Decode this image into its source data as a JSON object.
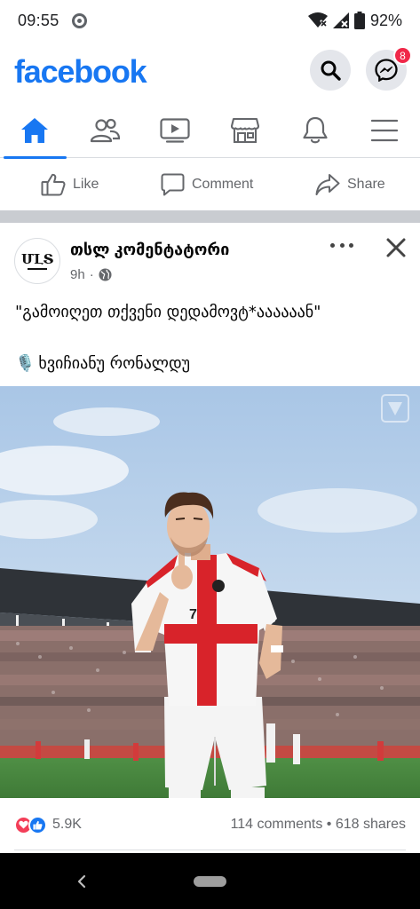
{
  "status_bar": {
    "time": "09:55",
    "battery": "92%"
  },
  "header": {
    "logo": "facebook",
    "messenger_badge": "8",
    "brand_color": "#1877f2",
    "badge_color": "#f02849"
  },
  "tabs": [
    {
      "name": "home",
      "icon": "home-icon",
      "active": true
    },
    {
      "name": "friends",
      "icon": "friends-icon",
      "active": false
    },
    {
      "name": "watch",
      "icon": "video-icon",
      "active": false
    },
    {
      "name": "marketplace",
      "icon": "store-icon",
      "active": false
    },
    {
      "name": "notifications",
      "icon": "bell-icon",
      "active": false
    },
    {
      "name": "menu",
      "icon": "hamburger-icon",
      "active": false
    }
  ],
  "actions": {
    "like": "Like",
    "comment": "Comment",
    "share": "Share"
  },
  "post": {
    "avatar_mark": "ՄԼՏ",
    "page_name": "თსლ კომენტატორი",
    "time": "9h",
    "separator": "·",
    "text_line_1": "\"გამოიღეთ თქვენი დედამოვტ*აააააან\"",
    "text_line_2": "ხვიჩიანუ რონალდუ",
    "mic_emoji": "🎙️",
    "reactions_count": "5.9K",
    "comments": "114 comments",
    "dot": "•",
    "shares": "618 shares"
  }
}
